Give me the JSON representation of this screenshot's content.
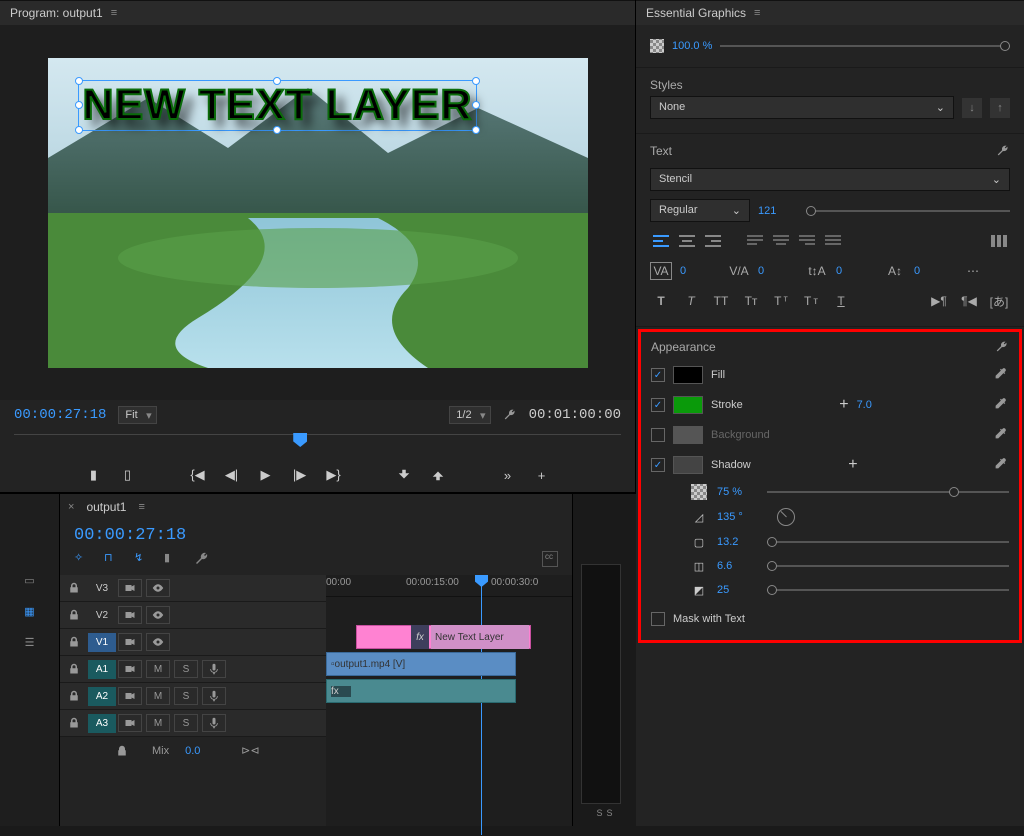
{
  "program": {
    "title": "Program: output1",
    "text_layer": "NEW TEXT LAYER",
    "current_time": "00:00:27:18",
    "fit_label": "Fit",
    "zoom_label": "1/2",
    "duration": "00:01:00:00"
  },
  "timeline": {
    "tab": "output1",
    "current_time": "00:00:27:18",
    "ruler": {
      "t0": "00:00",
      "t1": "00:00:15:00",
      "t2": "00:00:30:0"
    },
    "tracks": {
      "v3": "V3",
      "v2": "V2",
      "v1": "V1",
      "a1": "A1",
      "a2": "A2",
      "a3": "A3",
      "mix": "Mix",
      "m": "M",
      "s": "S"
    },
    "clips": {
      "text": "New Text Layer",
      "video": "output1.mp4 [V]",
      "fx": "fx"
    },
    "mix_val": "0.0"
  },
  "eg": {
    "title": "Essential Graphics",
    "opacity": "100.0 %",
    "styles_label": "Styles",
    "style_value": "None",
    "text_label": "Text",
    "font": "Stencil",
    "weight": "Regular",
    "size": "121",
    "tracking": "0",
    "kerning": "0",
    "leading": "0",
    "baseline": "0",
    "appearance_label": "Appearance",
    "fill_label": "Fill",
    "stroke_label": "Stroke",
    "stroke_val": "7.0",
    "background_label": "Background",
    "shadow_label": "Shadow",
    "shadow_opacity": "75 %",
    "shadow_angle": "135 °",
    "shadow_distance": "13.2",
    "shadow_spread": "6.6",
    "shadow_blur": "25",
    "mask_label": "Mask with Text"
  },
  "meters": {
    "s": "S"
  }
}
